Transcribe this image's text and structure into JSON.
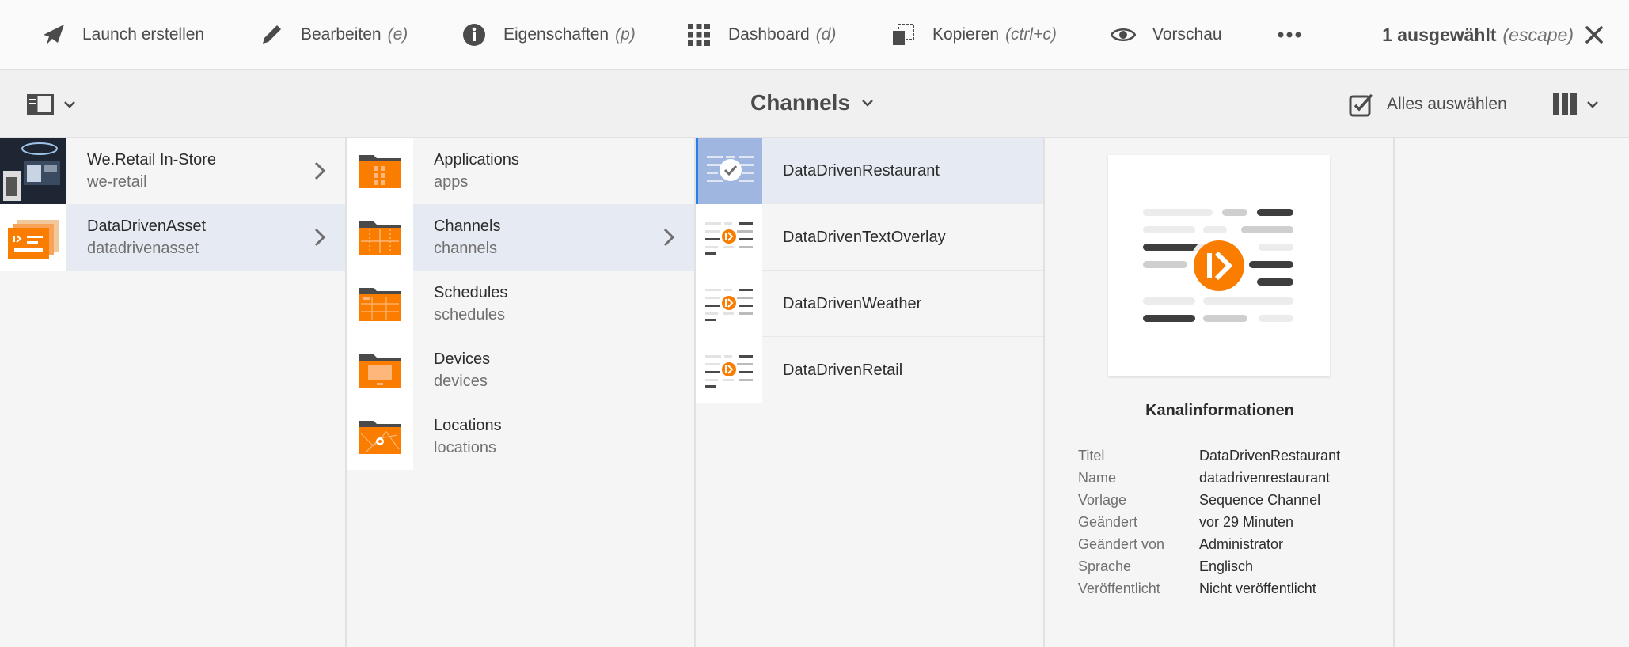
{
  "actionbar": {
    "launch": "Launch erstellen",
    "edit": "Bearbeiten",
    "edit_sc": "(e)",
    "properties": "Eigenschaften",
    "properties_sc": "(p)",
    "dashboard": "Dashboard",
    "dashboard_sc": "(d)",
    "copy": "Kopieren",
    "copy_sc": "(ctrl+c)",
    "preview": "Vorschau",
    "selection": "1 ausgewählt",
    "selection_sc": "(escape)"
  },
  "titlebar": {
    "title": "Channels",
    "select_all": "Alles auswählen"
  },
  "column1": [
    {
      "title": "We.Retail In-Store",
      "name": "we-retail"
    },
    {
      "title": "DataDrivenAsset",
      "name": "datadrivenasset"
    }
  ],
  "column2": [
    {
      "title": "Applications",
      "name": "apps"
    },
    {
      "title": "Channels",
      "name": "channels"
    },
    {
      "title": "Schedules",
      "name": "schedules"
    },
    {
      "title": "Devices",
      "name": "devices"
    },
    {
      "title": "Locations",
      "name": "locations"
    }
  ],
  "column3": [
    {
      "title": "DataDrivenRestaurant"
    },
    {
      "title": "DataDrivenTextOverlay"
    },
    {
      "title": "DataDrivenWeather"
    },
    {
      "title": "DataDrivenRetail"
    }
  ],
  "details": {
    "heading": "Kanalinformationen",
    "fields": [
      {
        "key": "Titel",
        "value": "DataDrivenRestaurant"
      },
      {
        "key": "Name",
        "value": "datadrivenrestaurant"
      },
      {
        "key": "Vorlage",
        "value": "Sequence Channel"
      },
      {
        "key": "Geändert",
        "value": "vor 29 Minuten"
      },
      {
        "key": "Geändert von",
        "value": "Administrator"
      },
      {
        "key": "Sprache",
        "value": "Englisch"
      },
      {
        "key": "Veröffentlicht",
        "value": "Nicht veröffentlicht"
      }
    ]
  },
  "colors": {
    "accent": "#fa7d00",
    "selected_row": "#e6ebf3",
    "text": "#4b4b4b"
  }
}
